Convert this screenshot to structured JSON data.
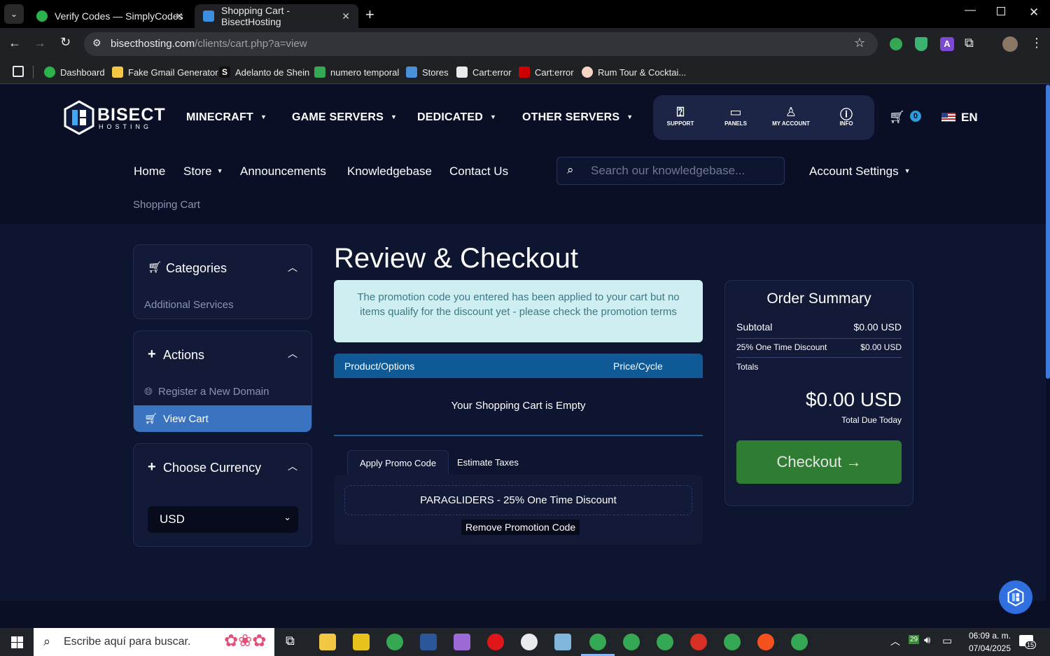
{
  "browser": {
    "tabs": [
      {
        "title": "Verify Codes — SimplyCodes",
        "active": false
      },
      {
        "title": "Shopping Cart - BisectHosting",
        "active": true
      }
    ],
    "url": {
      "host": "bisecthosting.com",
      "path": "/clients/cart.php?a=view"
    },
    "bookmarks": [
      "Dashboard",
      "Fake Gmail Generator",
      "Adelanto de Shein",
      "numero temporal",
      "Stores",
      "Cart:error",
      "Cart:error",
      "Rum Tour & Cocktai..."
    ]
  },
  "site": {
    "logo": {
      "line1": "BISECT",
      "line2": "HOSTING"
    },
    "main_nav": [
      "MINECRAFT",
      "GAME SERVERS",
      "DEDICATED",
      "OTHER SERVERS"
    ],
    "icon_bar": [
      "SUPPORT",
      "PANELS",
      "MY ACCOUNT",
      "INFO"
    ],
    "cart_count": "0",
    "language": "EN",
    "sub_nav": [
      "Home",
      "Store",
      "Announcements",
      "Knowledgebase",
      "Contact Us"
    ],
    "search_placeholder": "Search our knowledgebase...",
    "account_settings": "Account Settings",
    "breadcrumb": "Shopping Cart"
  },
  "sidebar": {
    "categories": {
      "title": "Categories",
      "items": [
        "Additional Services"
      ]
    },
    "actions": {
      "title": "Actions",
      "items": [
        "Register a New Domain",
        "View Cart"
      ]
    },
    "currency": {
      "title": "Choose Currency",
      "selected": "USD"
    }
  },
  "main": {
    "page_title": "Review & Checkout",
    "alert": "The promotion code you entered has been applied to your cart but no items qualify for the discount yet - please check the promotion terms",
    "table_headers": [
      "Product/Options",
      "Price/Cycle"
    ],
    "empty_message": "Your Shopping Cart is Empty",
    "tabs": [
      "Apply Promo Code",
      "Estimate Taxes"
    ],
    "promo_code": "PARAGLIDERS - 25% One Time Discount",
    "remove_promo": "Remove Promotion Code"
  },
  "summary": {
    "title": "Order Summary",
    "subtotal_label": "Subtotal",
    "subtotal_value": "$0.00 USD",
    "discount_label": "25% One Time Discount",
    "discount_value": "$0.00 USD",
    "totals_label": "Totals",
    "total_value": "$0.00 USD",
    "total_due_label": "Total Due Today",
    "checkout_label": "Checkout"
  },
  "taskbar": {
    "search_placeholder": "Escribe aquí para buscar.",
    "weather_temp": "29",
    "time": "06:09 a. m.",
    "date": "07/04/2025",
    "notifications": "15"
  },
  "colors": {
    "page_bg": "#0e1530",
    "header_bg": "#0a0f26",
    "accent_blue": "#0f5a96",
    "checkout_green": "#2e7d32",
    "alert_bg": "#cfeef2",
    "view_cart_active": "#3a74c0"
  }
}
